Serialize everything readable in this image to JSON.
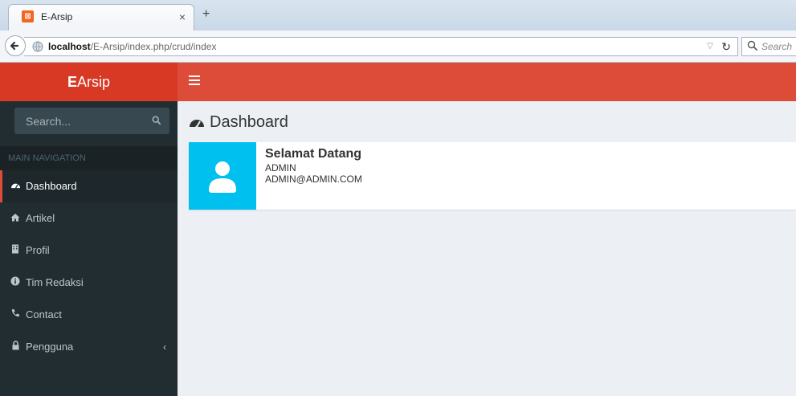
{
  "browser": {
    "tab_title": "E-Arsip",
    "tab_close": "×",
    "new_tab": "+",
    "url_host": "localhost",
    "url_path": "/E-Arsip/index.php/crud/index",
    "search_placeholder": "Search"
  },
  "app": {
    "logo_bold": "E",
    "logo_rest": "Arsip",
    "accent": "#dd4b39",
    "logo_bg": "#d73925",
    "sidebar_bg": "#222d32",
    "info_icon_bg": "#00c0ef"
  },
  "sidebar": {
    "search_placeholder": "Search...",
    "header": "MAIN NAVIGATION",
    "items": [
      {
        "label": "Dashboard",
        "icon": "dashboard-icon",
        "active": true
      },
      {
        "label": "Artikel",
        "icon": "home-icon"
      },
      {
        "label": "Profil",
        "icon": "building-icon"
      },
      {
        "label": "Tim Redaksi",
        "icon": "info-icon"
      },
      {
        "label": "Contact",
        "icon": "phone-icon"
      },
      {
        "label": "Pengguna",
        "icon": "lock-icon",
        "chevron": "‹"
      }
    ]
  },
  "main": {
    "title": "Dashboard",
    "welcome": {
      "title": "Selamat Datang",
      "name": "ADMIN",
      "email": "ADMIN@ADMIN.COM",
      "icon": "user-icon"
    }
  }
}
